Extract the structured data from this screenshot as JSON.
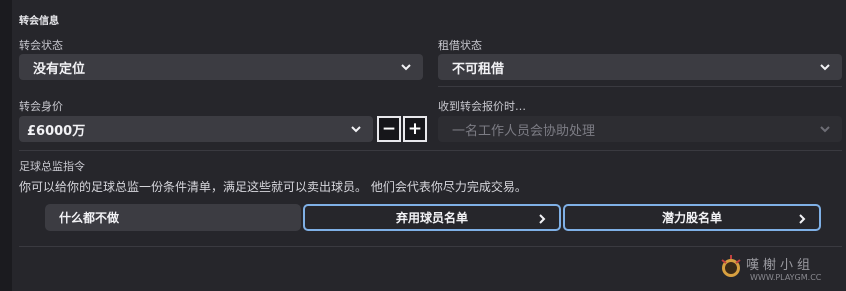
{
  "section_title": "转会信息",
  "transfer_status": {
    "label": "转会状态",
    "value": "没有定位"
  },
  "loan_status": {
    "label": "租借状态",
    "value": "不可租借"
  },
  "transfer_value": {
    "label": "转会身价",
    "value": "£6000万",
    "minus_label": "−",
    "plus_label": "+"
  },
  "on_offer": {
    "label": "收到转会报价时…",
    "value": "一名工作人员会协助处理"
  },
  "director": {
    "label": "足球总监指令",
    "description": "你可以给你的足球总监一份条件清单，满足这些就可以卖出球员。 他们会代表你尽力完成交易。",
    "action_value": "什么都不做",
    "discard_button": "弃用球员名单",
    "potential_button": "潜力股名单"
  },
  "watermark": {
    "text": "嘆榭小组",
    "url": "WWW.PLAYGM.CC"
  },
  "colors": {
    "accent_outline": "#7fb0e6",
    "panel": "#26262b",
    "control": "#3c3c42"
  }
}
